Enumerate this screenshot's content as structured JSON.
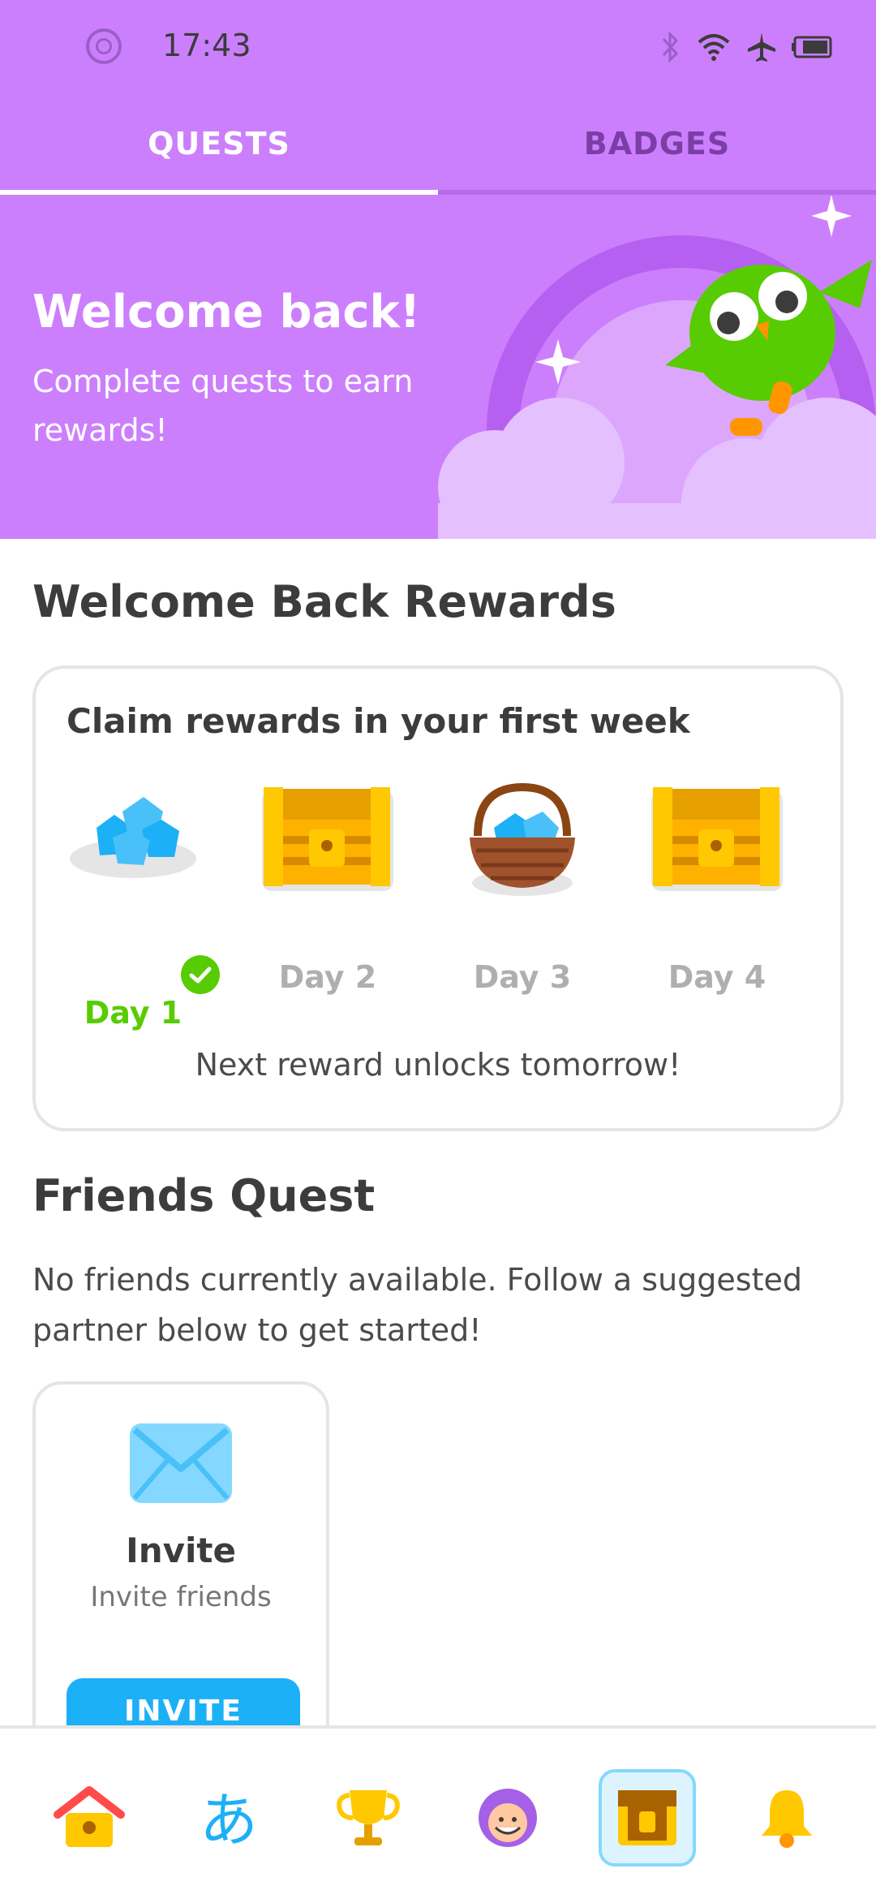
{
  "status_bar": {
    "time": "17:43"
  },
  "tabs": [
    {
      "label": "QUESTS"
    },
    {
      "label": "BADGES"
    }
  ],
  "hero": {
    "title": "Welcome back!",
    "subtitle": "Complete quests to earn rewards!"
  },
  "rewards": {
    "heading": "Welcome Back Rewards",
    "card_title": "Claim rewards in your first week",
    "days": [
      {
        "label": "Day 1",
        "icon": "gems-icon",
        "claimed": true
      },
      {
        "label": "Day 2",
        "icon": "chest-icon",
        "claimed": false
      },
      {
        "label": "Day 3",
        "icon": "gem-basket-icon",
        "claimed": false
      },
      {
        "label": "Day 4",
        "icon": "chest-icon",
        "claimed": false
      }
    ],
    "footer": "Next reward unlocks tomorrow!"
  },
  "friends": {
    "heading": "Friends Quest",
    "text": "No friends currently available. Follow a suggested partner below to get started!",
    "invite_card": {
      "title": "Invite",
      "subtitle": "Invite friends",
      "button": "INVITE"
    }
  },
  "nav": [
    {
      "icon": "home-icon"
    },
    {
      "icon": "characters-icon"
    },
    {
      "icon": "trophy-icon"
    },
    {
      "icon": "profile-icon"
    },
    {
      "icon": "quests-chest-icon",
      "selected": true
    },
    {
      "icon": "bell-icon"
    }
  ],
  "colors": {
    "primary": "#CC7FFC",
    "green": "#58CC02",
    "blue": "#1CB0F6"
  }
}
